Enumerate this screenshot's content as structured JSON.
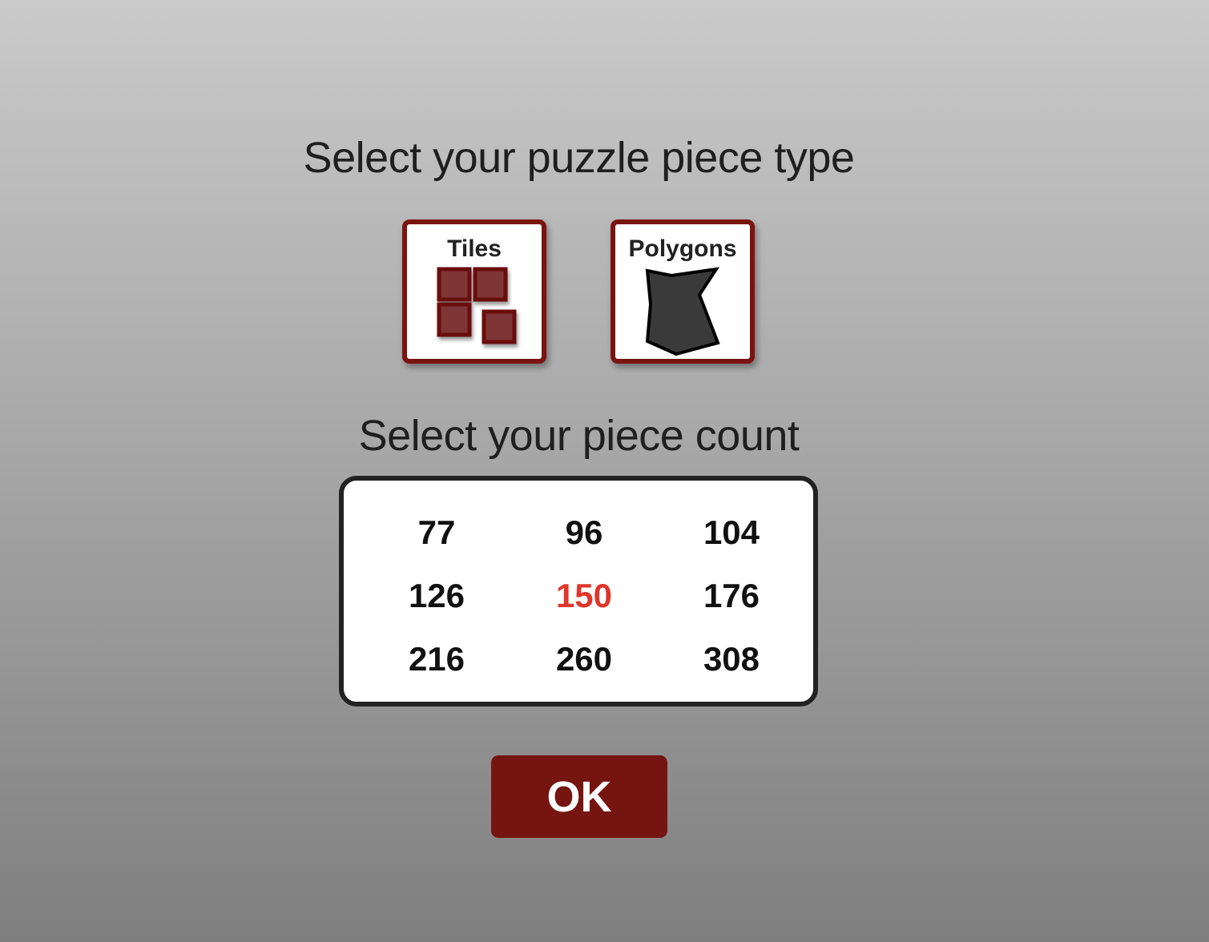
{
  "piece_type": {
    "heading": "Select your puzzle piece type",
    "options": [
      {
        "label": "Tiles",
        "icon": "tiles-icon"
      },
      {
        "label": "Polygons",
        "icon": "polygon-icon"
      }
    ]
  },
  "piece_count": {
    "heading": "Select your piece count",
    "options": [
      "77",
      "96",
      "104",
      "126",
      "150",
      "176",
      "216",
      "260",
      "308"
    ],
    "selected": "150",
    "selected_color": "#e0352b"
  },
  "ok_button": {
    "label": "OK"
  },
  "colors": {
    "accent": "#761410",
    "card_border": "#7a1410",
    "tile_fill": "#7e3534",
    "polygon_fill": "#3a3a3a"
  }
}
